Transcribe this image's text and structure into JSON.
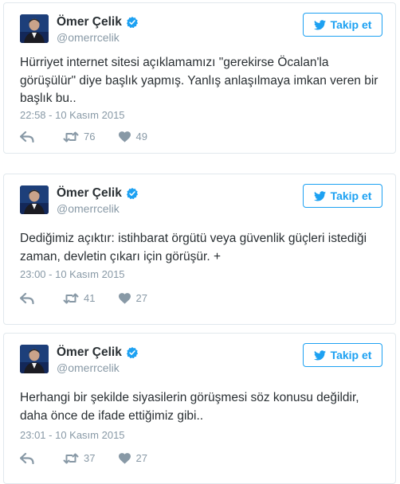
{
  "colors": {
    "accent": "#1da1f2",
    "text": "#292f33",
    "muted": "#8899a6",
    "border": "#e1e8ed"
  },
  "follow_label": "Takip et",
  "icons": {
    "bird": "twitter-bird-icon",
    "verified": "verified-badge-icon",
    "reply": "reply-icon",
    "retweet": "retweet-icon",
    "like": "heart-icon"
  },
  "tweets": [
    {
      "name": "Ömer Çelik",
      "handle": "@omerrcelik",
      "text": "Hürriyet internet sitesi açıklamamızı \"gerekirse Öcalan'la görüşülür\" diye başlık yapmış. Yanlış anlaşılmaya imkan veren bir başlık bu..",
      "time": "22:58 - 10 Kasım 2015",
      "retweets": "76",
      "likes": "49"
    },
    {
      "name": "Ömer Çelik",
      "handle": "@omerrcelik",
      "text": "Dediğimiz açıktır: istihbarat örgütü veya güvenlik güçleri istediği zaman, devletin çıkarı için görüşür. +",
      "time": "23:00 - 10 Kasım 2015",
      "retweets": "41",
      "likes": "27"
    },
    {
      "name": "Ömer Çelik",
      "handle": "@omerrcelik",
      "text": "Herhangi bir şekilde siyasilerin görüşmesi söz konusu değildir, daha önce de ifade ettiğimiz gibi..",
      "time": "23:01 - 10 Kasım 2015",
      "retweets": "37",
      "likes": "27"
    }
  ]
}
